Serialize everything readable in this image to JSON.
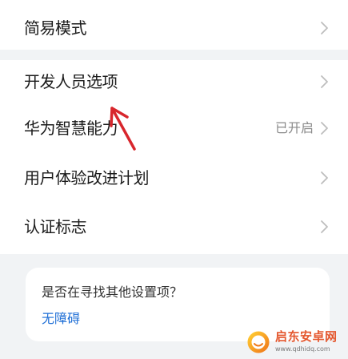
{
  "settings": {
    "group_top": [
      {
        "label": "简易模式"
      }
    ],
    "group_main": [
      {
        "label": "开发人员选项"
      },
      {
        "label": "华为智慧能力",
        "value": "已开启"
      },
      {
        "label": "用户体验改进计划"
      },
      {
        "label": "认证标志"
      }
    ]
  },
  "suggestion_card": {
    "question": "是否在寻找其他设置项？",
    "link": "无障碍"
  },
  "watermark": {
    "site_name": "启东安卓网",
    "site_url": "www.qdhidq.com"
  },
  "icons": {
    "row_arrow": "chevron-right-icon",
    "watermark_logo": "watermark-logo-icon",
    "annotation": "red-arrow-annotation"
  },
  "colors": {
    "background": "#f1f3f5",
    "text_primary": "#1b1b1b",
    "text_secondary": "#8a8a8a",
    "chevron": "#bdbdbd",
    "link": "#1f6fd6",
    "annotation": "#d8262c",
    "watermark": "#e4572e"
  }
}
